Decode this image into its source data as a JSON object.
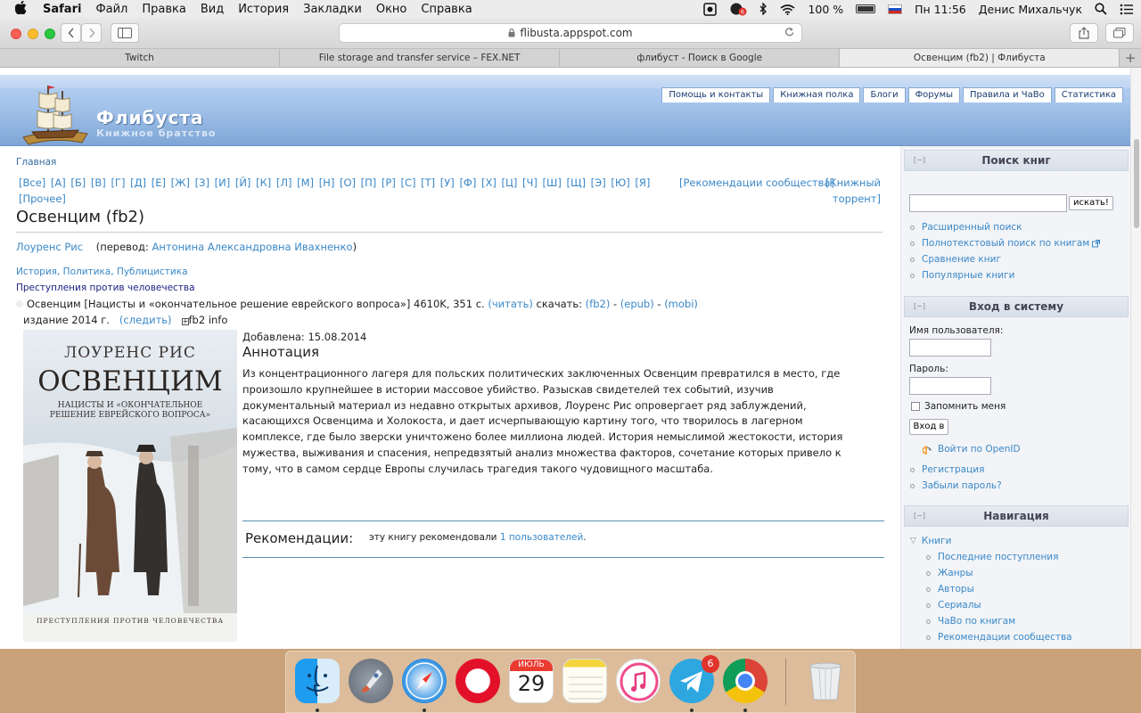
{
  "menubar": {
    "app": "Safari",
    "items": [
      "Файл",
      "Правка",
      "Вид",
      "История",
      "Закладки",
      "Окно",
      "Справка"
    ],
    "battery": "100 %",
    "datetime": "Пн 11:56",
    "user": "Денис Михальчук",
    "notif_badge": "6"
  },
  "browser": {
    "url": "flibusta.appspot.com",
    "tabs": [
      {
        "label": "Twitch"
      },
      {
        "label": "File storage and transfer service – FEX.NET"
      },
      {
        "label": "флибуст - Поиск в Google"
      },
      {
        "label": "Освенцим (fb2) | Флибуста"
      }
    ]
  },
  "site": {
    "name": "Флибуста",
    "slogan": "Книжное братство",
    "toplinks": [
      "Помощь и контакты",
      "Книжная полка",
      "Блоги",
      "Форумы",
      "Правила и ЧаВо",
      "Статистика"
    ]
  },
  "content": {
    "breadcrumb": "Главная",
    "alphabet_line1": "[Все] [А] [Б] [В] [Г] [Д] [Е] [Ж] [З] [И] [Й] [К] [Л] [М] [Н] [О] [П] [Р] [С] [Т] [У] [Ф] [Х] [Ц] [Ч] [Ш] [Щ] [Э] [Ю] [Я]",
    "alphabet_line2": "[Прочее]",
    "recommendations_link": "[Рекомендации сообщества]",
    "torrent_link1": "[Книжный",
    "torrent_link2": "торрент]",
    "title": "Освенцим (fb2)",
    "author": "Лоуренс Рис",
    "translation_prefix": "(перевод:",
    "translator": "Антонина Александровна Ивахненко",
    "translation_suffix": ")",
    "genres": [
      "История",
      "Политика",
      "Публицистика"
    ],
    "series": "Преступления против человечества",
    "file_info": "Освенцим [Нацисты и «окончательное решение еврейского вопроса»] 4610K, 351 с.",
    "read_link": "(читать)",
    "download_label": "скачать:",
    "formats": [
      "(fb2)",
      "(epub)",
      "(mobi)"
    ],
    "edition": "издание 2014 г.",
    "follow_link": "(следить)",
    "fb2info": "fb2 info",
    "added": "Добавлена: 15.08.2014",
    "annotation_heading": "Аннотация",
    "annotation": "Из концентрационного лагеря для польских политических заключенных Освенцим превратился в место, где произошло крупнейшее в истории массовое убийство. Разыскав свидетелей тех событий, изучив документальный материал из недавно открытых архивов, Лоуренс Рис опровергает ряд заблуждений, касающихся Освенцима и Холокоста, и дает исчерпывающую картину того, что творилось в лагерном комплексе, где было зверски уничтожено более миллиона людей. История немыслимой жестокости, история мужества, выживания и спасения, непредвзятый анализ множества факторов, сочетание которых привело к тому, что в самом сердце Европы случилась трагедия такого чудовищного масштаба.",
    "rec_heading": "Рекомендации:",
    "rec_text": "эту книгу рекомендовали",
    "rec_link": "1 пользователей",
    "rec_end": ".",
    "cover": {
      "author": "ЛОУРЕНС РИС",
      "title": "ОСВЕНЦИМ",
      "subtitle": "НАЦИСТЫ И «ОКОНЧАТЕЛЬНОЕ РЕШЕНИЕ ЕВРЕЙСКОГО ВОПРОСА»",
      "series": "ПРЕСТУПЛЕНИЯ ПРОТИВ ЧЕЛОВЕЧЕСТВА"
    }
  },
  "sidebar": {
    "collapse_marker": "[−]",
    "search": {
      "heading": "Поиск книг",
      "button": "искать!",
      "links": [
        "Расширенный поиск",
        "Полнотекстовый поиск по книгам",
        "Сравнение книг",
        "Популярные книги"
      ]
    },
    "login": {
      "heading": "Вход в систему",
      "username_label": "Имя пользователя:",
      "password_label": "Пароль:",
      "remember": "Запомнить меня",
      "button": "Вход в",
      "openid": "Войти по OpenID",
      "links": [
        "Регистрация",
        "Забыли пароль?"
      ]
    },
    "nav": {
      "heading": "Навигация",
      "root": "Книги",
      "items": [
        "Последние поступления",
        "Жанры",
        "Авторы",
        "Сериалы",
        "ЧаВо по книгам",
        "Рекомендации сообщества"
      ]
    }
  },
  "dock": {
    "calendar_month": "ИЮЛЬ",
    "calendar_day": "29",
    "telegram_badge": "6",
    "apps": [
      "finder",
      "launchpad",
      "safari",
      "opera",
      "calendar",
      "notes",
      "itunes",
      "telegram",
      "chrome",
      "trash"
    ]
  }
}
